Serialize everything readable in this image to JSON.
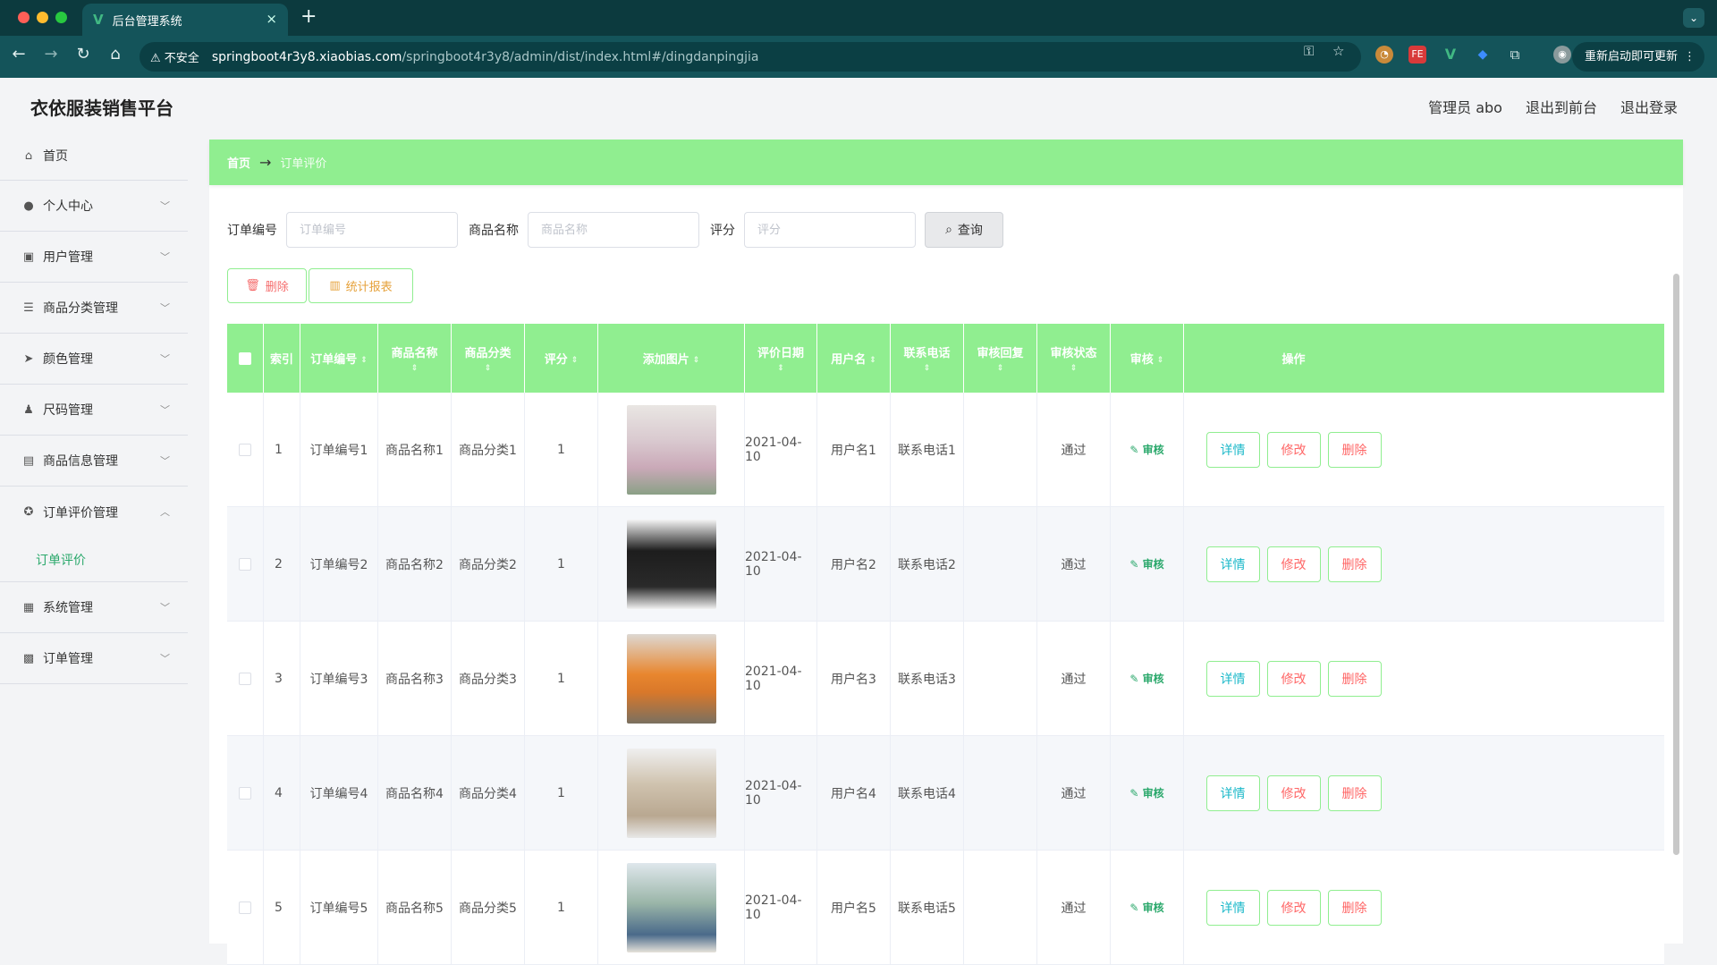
{
  "browser": {
    "tab_title": "后台管理系统",
    "tab_close": "×",
    "new_tab": "+",
    "not_secure": "不安全",
    "url_host": "springboot4r3y8.xiaobias.com",
    "url_path": "/springboot4r3y8/admin/dist/index.html#/dingdanpingjia",
    "update_label": "重新启动即可更新",
    "ext_fe": "FE",
    "ext_v": "V"
  },
  "header": {
    "app_title": "衣依服装销售平台",
    "user_label": "管理员 abo",
    "front_link": "退出到前台",
    "logout_link": "退出登录"
  },
  "sidebar": {
    "items": [
      {
        "label": "首页",
        "icon": "home-icon"
      },
      {
        "label": "个人中心",
        "icon": "user-icon"
      },
      {
        "label": "用户管理",
        "icon": "users-icon"
      },
      {
        "label": "商品分类管理",
        "icon": "list-icon"
      },
      {
        "label": "颜色管理",
        "icon": "send-icon"
      },
      {
        "label": "尺码管理",
        "icon": "person-icon"
      },
      {
        "label": "商品信息管理",
        "icon": "message-icon"
      },
      {
        "label": "订单评价管理",
        "icon": "star-icon"
      },
      {
        "label": "系统管理",
        "icon": "clipboard-icon"
      },
      {
        "label": "订单管理",
        "icon": "grid-icon"
      }
    ],
    "active_sub": "订单评价"
  },
  "breadcrumb": {
    "home": "首页",
    "current": "订单评价"
  },
  "search": {
    "order_label": "订单编号",
    "order_placeholder": "订单编号",
    "name_label": "商品名称",
    "name_placeholder": "商品名称",
    "score_label": "评分",
    "score_placeholder": "评分",
    "query_button": "查询"
  },
  "actions": {
    "delete": "删除",
    "report": "统计报表"
  },
  "table": {
    "headers": [
      "索引",
      "订单编号",
      "商品名称",
      "商品分类",
      "评分",
      "添加图片",
      "评价日期",
      "用户名",
      "联系电话",
      "审核回复",
      "审核状态",
      "审核",
      "操作"
    ],
    "audit_label": "审核",
    "op_detail": "详情",
    "op_edit": "修改",
    "op_delete": "删除",
    "rows": [
      {
        "index": "1",
        "order": "订单编号1",
        "name": "商品名称1",
        "category": "商品分类1",
        "score": "1",
        "date": "2021-04-10",
        "user": "用户名1",
        "phone": "联系电话1",
        "reply": "",
        "status": "通过"
      },
      {
        "index": "2",
        "order": "订单编号2",
        "name": "商品名称2",
        "category": "商品分类2",
        "score": "1",
        "date": "2021-04-10",
        "user": "用户名2",
        "phone": "联系电话2",
        "reply": "",
        "status": "通过"
      },
      {
        "index": "3",
        "order": "订单编号3",
        "name": "商品名称3",
        "category": "商品分类3",
        "score": "1",
        "date": "2021-04-10",
        "user": "用户名3",
        "phone": "联系电话3",
        "reply": "",
        "status": "通过"
      },
      {
        "index": "4",
        "order": "订单编号4",
        "name": "商品名称4",
        "category": "商品分类4",
        "score": "1",
        "date": "2021-04-10",
        "user": "用户名4",
        "phone": "联系电话4",
        "reply": "",
        "status": "通过"
      },
      {
        "index": "5",
        "order": "订单编号5",
        "name": "商品名称5",
        "category": "商品分类5",
        "score": "1",
        "date": "2021-04-10",
        "user": "用户名5",
        "phone": "联系电话5",
        "reply": "",
        "status": "通过"
      }
    ]
  },
  "colors": {
    "accent_green": "#90ee90",
    "active_text": "#2aa86b",
    "danger": "#f56c6c",
    "warning": "#e6a23c",
    "info": "#1bb8c9"
  }
}
